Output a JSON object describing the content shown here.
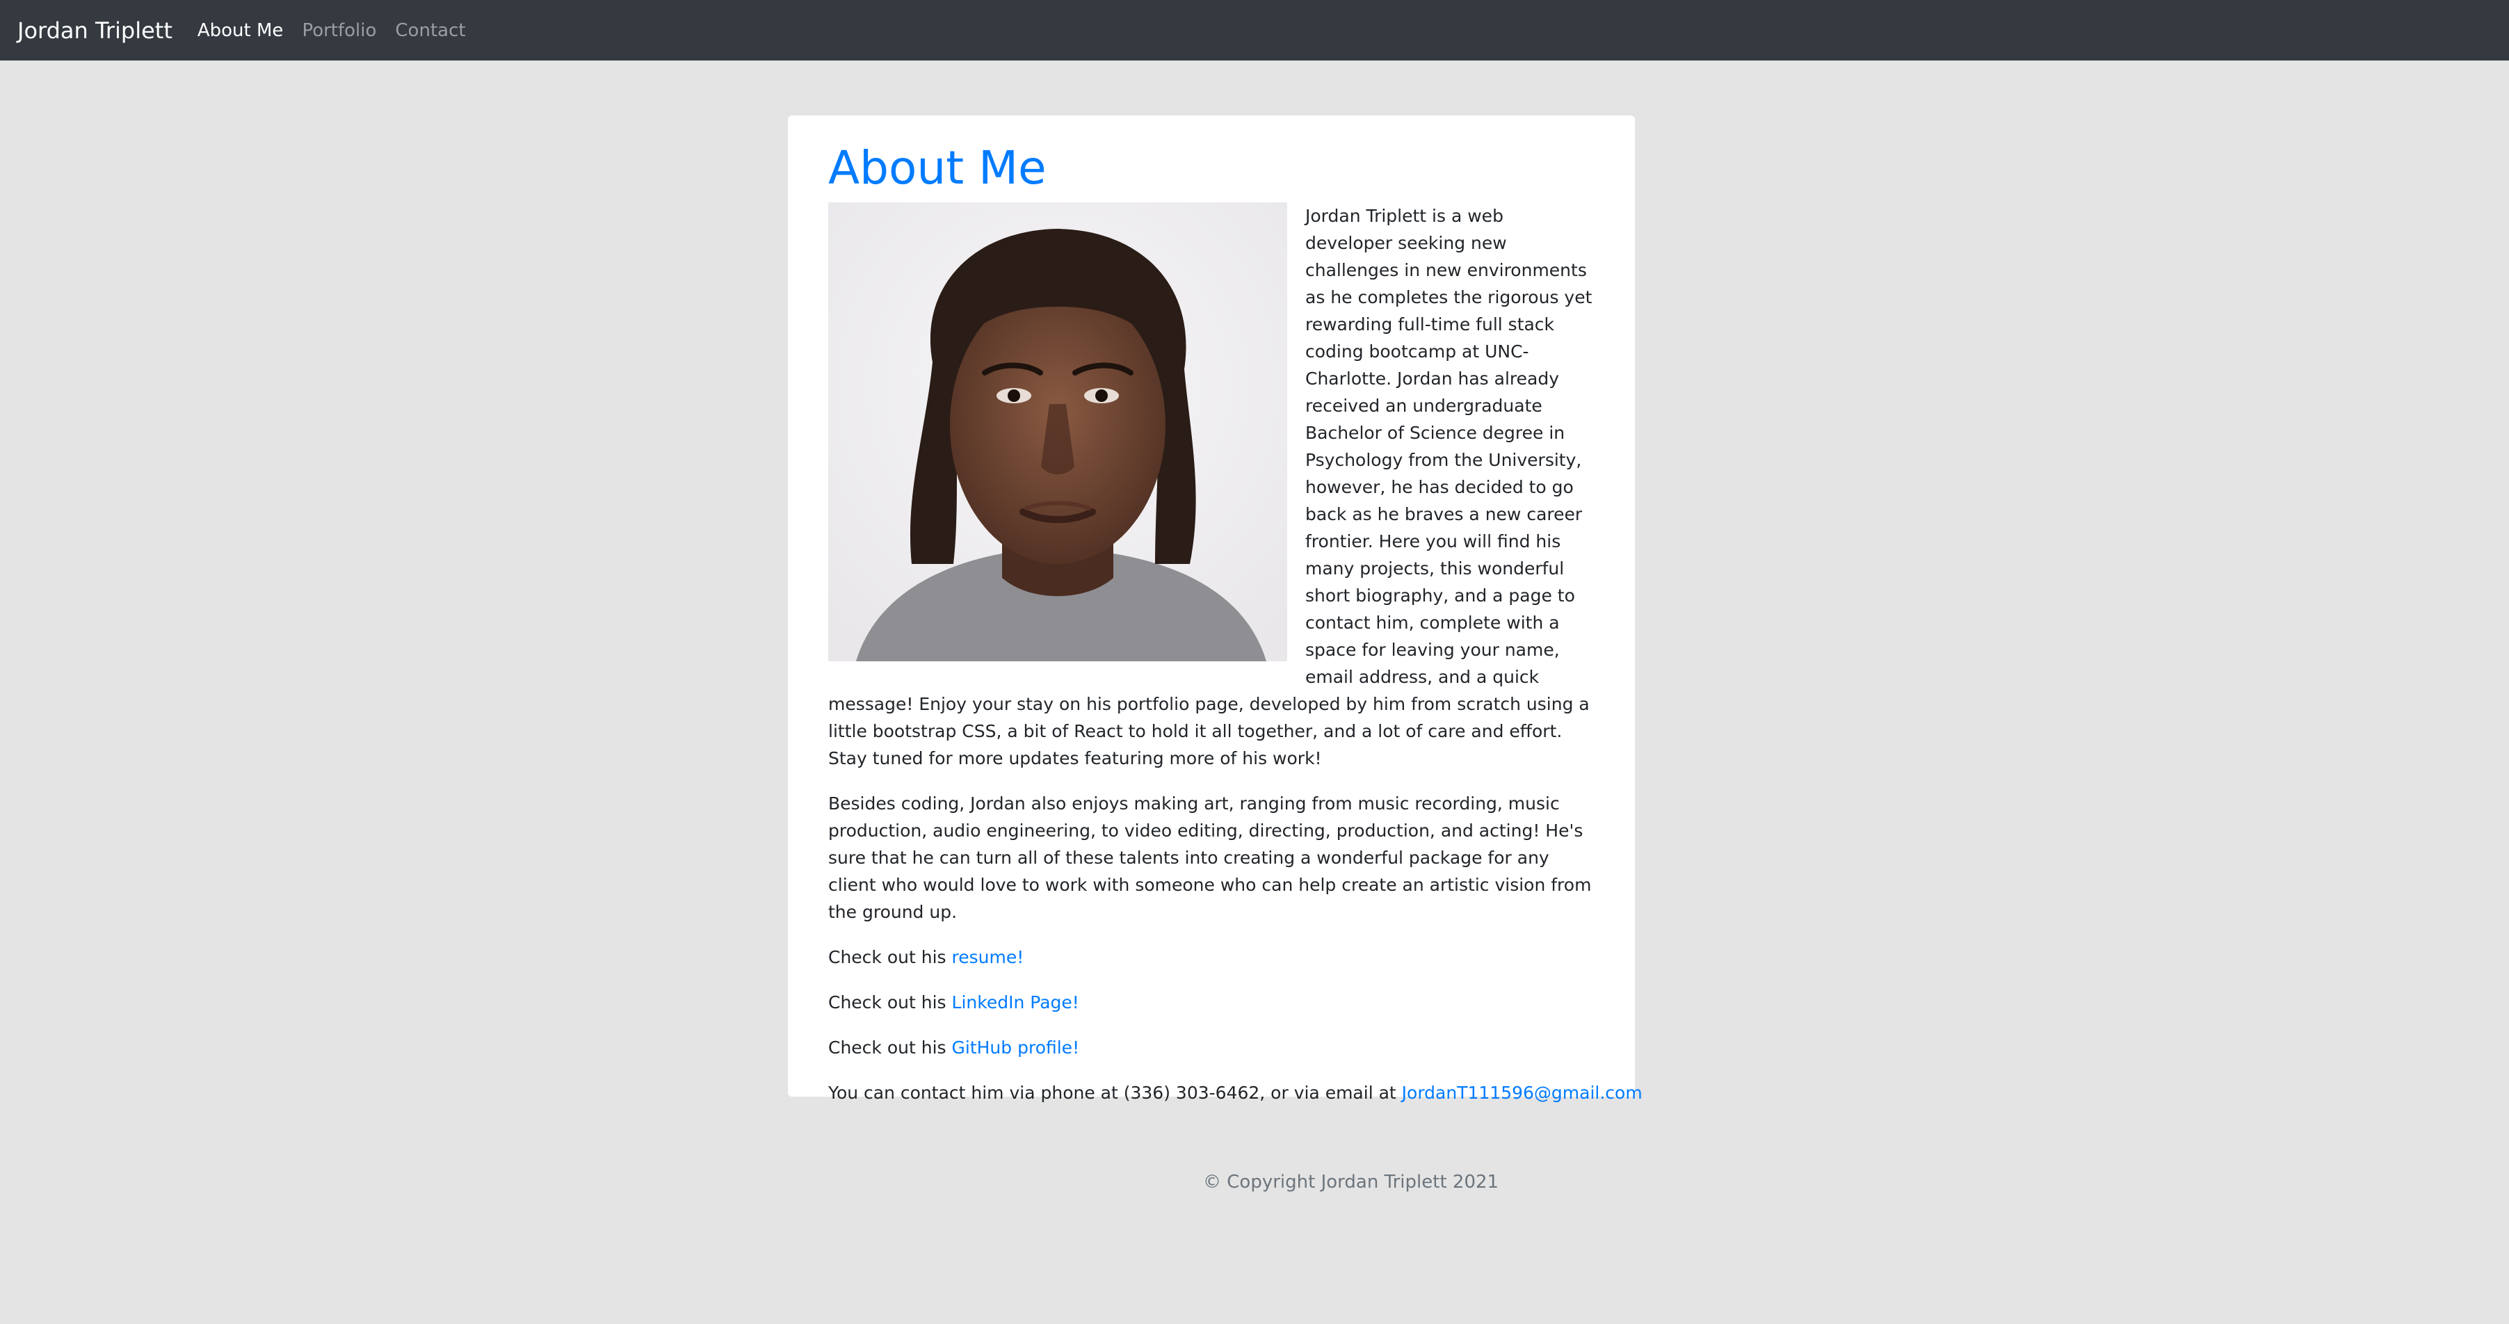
{
  "navbar": {
    "brand": "Jordan Triplett",
    "links": [
      {
        "label": "About Me",
        "active": true
      },
      {
        "label": "Portfolio",
        "active": false
      },
      {
        "label": "Contact",
        "active": false
      }
    ]
  },
  "about": {
    "title": "About Me",
    "photo_icon": "profile-photo",
    "bio_p1": "Jordan Triplett is a web developer seeking new challenges in new environments as he completes the rigorous yet rewarding full-time full stack coding bootcamp at UNC-Charlotte. Jordan has already received an undergraduate Bachelor of Science degree in Psychology from the University, however, he has decided to go back as he braves a new career frontier. Here you will find his many projects, this wonderful short biography, and a page to contact him, complete with a space for leaving your name, email address, and a quick message! Enjoy your stay on his portfolio page, developed by him from scratch using a little bootstrap CSS, a bit of React to hold it all together, and a lot of care and effort. Stay tuned for more updates featuring more of his work!",
    "bio_p2": "Besides coding, Jordan also enjoys making art, ranging from music recording, music production, audio engineering, to video editing, directing, production, and acting! He's sure that he can turn all of these talents into creating a wonderful package for any client who would love to work with someone who can help create an artistic vision from the ground up.",
    "check_prefix": "Check out his",
    "resume_link": "resume!",
    "linkedin_link": "LinkedIn Page!",
    "github_link": "GitHub profile!",
    "contact_text": "You can contact him via phone at (336) 303-6462, or via email at",
    "email_link": "JordanT111596@gmail.com"
  },
  "footer": {
    "copyright": "© Copyright Jordan Triplett 2021"
  },
  "colors": {
    "navbar_bg": "#343a40",
    "page_bg": "#e4e4e4",
    "accent": "#007bff"
  }
}
